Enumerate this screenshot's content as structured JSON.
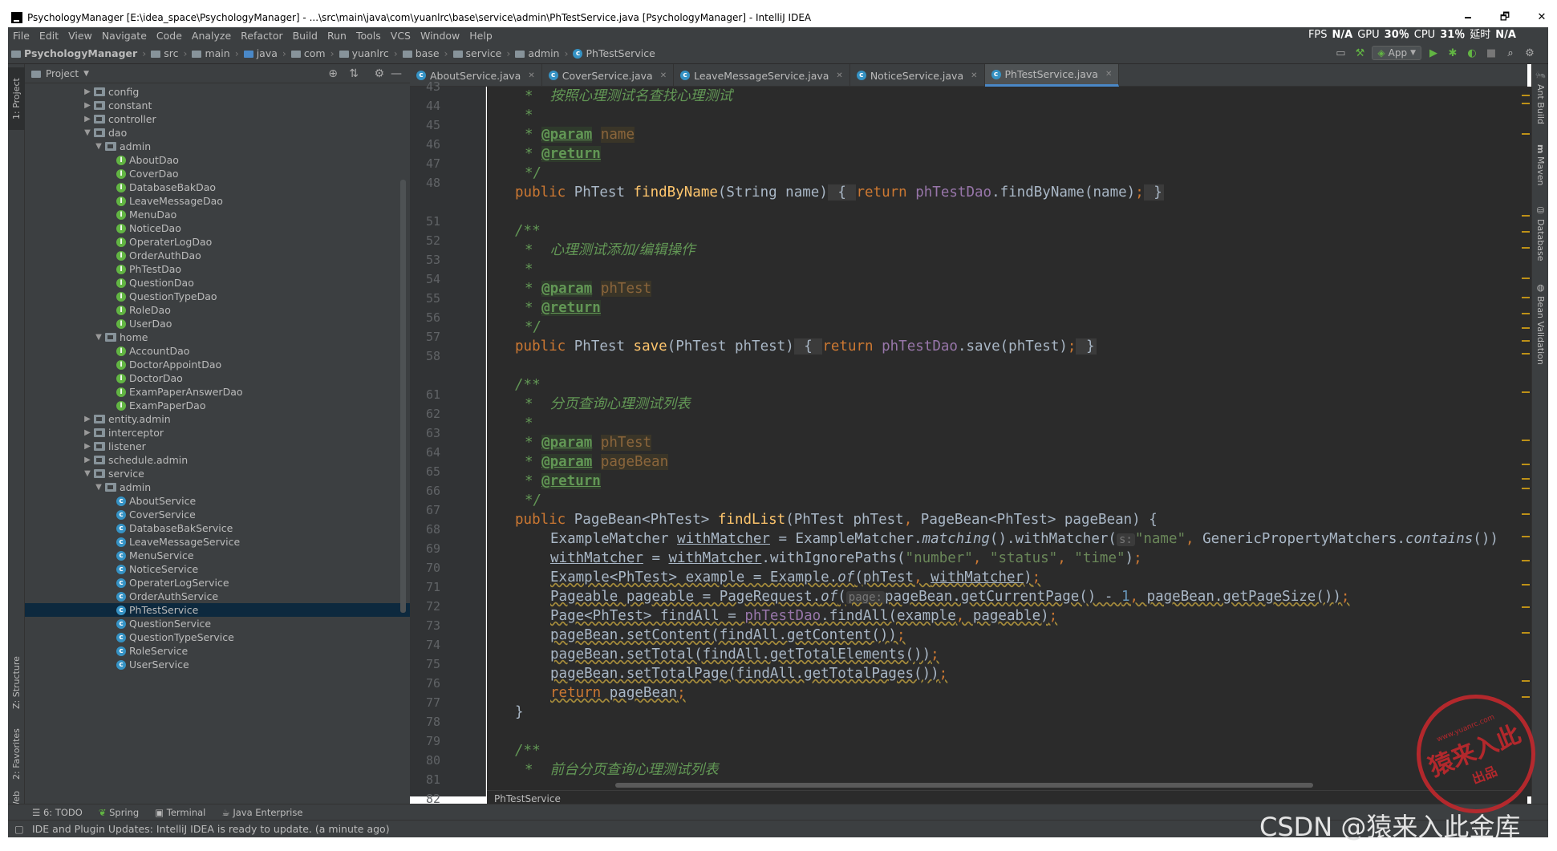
{
  "window": {
    "title": "PsychologyManager [E:\\idea_space\\PsychologyManager] - ...\\src\\main\\java\\com\\yuanlrc\\base\\service\\admin\\PhTestService.java [PsychologyManager] - IntelliJ IDEA",
    "minimize": "🗕",
    "maximize": "🗗",
    "close": "✕"
  },
  "menu": [
    "File",
    "Edit",
    "View",
    "Navigate",
    "Code",
    "Analyze",
    "Refactor",
    "Build",
    "Run",
    "Tools",
    "VCS",
    "Window",
    "Help"
  ],
  "perf": {
    "fps_label": "FPS",
    "fps": "N/A",
    "gpu_label": "GPU",
    "gpu": "30％",
    "cpu_label": "CPU",
    "cpu": "31％",
    "delay_label": "延时",
    "delay": "N/A"
  },
  "breadcrumb": [
    "PsychologyManager",
    "src",
    "main",
    "java",
    "com",
    "yuanlrc",
    "base",
    "service",
    "admin",
    "PhTestService"
  ],
  "run_config": "App",
  "left_tabs": [
    "1: Project",
    "Z: Structure",
    "2: Favorites",
    "Web"
  ],
  "right_tabs": [
    "Ant Build",
    "Maven",
    "Database",
    "Bean Validation"
  ],
  "project_panel": {
    "title": "Project"
  },
  "tree": [
    {
      "depth": 0,
      "type": "folder",
      "arrow": "▶",
      "label": "config"
    },
    {
      "depth": 0,
      "type": "folder",
      "arrow": "▶",
      "label": "constant"
    },
    {
      "depth": 0,
      "type": "folder",
      "arrow": "▶",
      "label": "controller"
    },
    {
      "depth": 0,
      "type": "folder",
      "arrow": "▼",
      "label": "dao"
    },
    {
      "depth": 1,
      "type": "folder",
      "arrow": "▼",
      "label": "admin"
    },
    {
      "depth": 2,
      "type": "iface",
      "label": "AboutDao"
    },
    {
      "depth": 2,
      "type": "iface",
      "label": "CoverDao"
    },
    {
      "depth": 2,
      "type": "iface",
      "label": "DatabaseBakDao"
    },
    {
      "depth": 2,
      "type": "iface",
      "label": "LeaveMessageDao"
    },
    {
      "depth": 2,
      "type": "iface",
      "label": "MenuDao"
    },
    {
      "depth": 2,
      "type": "iface",
      "label": "NoticeDao"
    },
    {
      "depth": 2,
      "type": "iface",
      "label": "OperaterLogDao"
    },
    {
      "depth": 2,
      "type": "iface",
      "label": "OrderAuthDao"
    },
    {
      "depth": 2,
      "type": "iface",
      "label": "PhTestDao"
    },
    {
      "depth": 2,
      "type": "iface",
      "label": "QuestionDao"
    },
    {
      "depth": 2,
      "type": "iface",
      "label": "QuestionTypeDao"
    },
    {
      "depth": 2,
      "type": "iface",
      "label": "RoleDao"
    },
    {
      "depth": 2,
      "type": "iface",
      "label": "UserDao"
    },
    {
      "depth": 1,
      "type": "folder",
      "arrow": "▼",
      "label": "home"
    },
    {
      "depth": 2,
      "type": "iface",
      "label": "AccountDao"
    },
    {
      "depth": 2,
      "type": "iface",
      "label": "DoctorAppointDao"
    },
    {
      "depth": 2,
      "type": "iface",
      "label": "DoctorDao"
    },
    {
      "depth": 2,
      "type": "iface",
      "label": "ExamPaperAnswerDao"
    },
    {
      "depth": 2,
      "type": "iface",
      "label": "ExamPaperDao"
    },
    {
      "depth": 0,
      "type": "folder",
      "arrow": "▶",
      "label": "entity.admin"
    },
    {
      "depth": 0,
      "type": "folder",
      "arrow": "▶",
      "label": "interceptor"
    },
    {
      "depth": 0,
      "type": "folder",
      "arrow": "▶",
      "label": "listener"
    },
    {
      "depth": 0,
      "type": "folder",
      "arrow": "▶",
      "label": "schedule.admin"
    },
    {
      "depth": 0,
      "type": "folder",
      "arrow": "▼",
      "label": "service"
    },
    {
      "depth": 1,
      "type": "folder",
      "arrow": "▼",
      "label": "admin"
    },
    {
      "depth": 2,
      "type": "class",
      "label": "AboutService"
    },
    {
      "depth": 2,
      "type": "class",
      "label": "CoverService"
    },
    {
      "depth": 2,
      "type": "class",
      "label": "DatabaseBakService"
    },
    {
      "depth": 2,
      "type": "class",
      "label": "LeaveMessageService"
    },
    {
      "depth": 2,
      "type": "class",
      "label": "MenuService"
    },
    {
      "depth": 2,
      "type": "class",
      "label": "NoticeService"
    },
    {
      "depth": 2,
      "type": "class",
      "label": "OperaterLogService"
    },
    {
      "depth": 2,
      "type": "class",
      "label": "OrderAuthService"
    },
    {
      "depth": 2,
      "type": "class",
      "label": "PhTestService",
      "selected": true
    },
    {
      "depth": 2,
      "type": "class",
      "label": "QuestionService"
    },
    {
      "depth": 2,
      "type": "class",
      "label": "QuestionTypeService"
    },
    {
      "depth": 2,
      "type": "class",
      "label": "RoleService"
    },
    {
      "depth": 2,
      "type": "class",
      "label": "UserService"
    }
  ],
  "editor_tabs": [
    {
      "label": "AboutService.java",
      "active": false
    },
    {
      "label": "CoverService.java",
      "active": false
    },
    {
      "label": "LeaveMessageService.java",
      "active": false
    },
    {
      "label": "NoticeService.java",
      "active": false
    },
    {
      "label": "PhTestService.java",
      "active": true
    }
  ],
  "line_numbers": [
    "43",
    "44",
    "45",
    "46",
    "47",
    "48",
    "51",
    "52",
    "53",
    "54",
    "55",
    "56",
    "57",
    "58",
    "61",
    "62",
    "63",
    "64",
    "65",
    "66",
    "67",
    "68",
    "69",
    "70",
    "71",
    "72",
    "73",
    "74",
    "75",
    "76",
    "77",
    "78",
    "79",
    "80",
    "81",
    "82"
  ],
  "code": {
    "c43": "按照心理测试名查找心理测试",
    "c45_tag": "@param",
    "c45_p": "name",
    "c46_tag": "@return",
    "c53": "心理测试添加/编辑操作",
    "c55_tag": "@param",
    "c55_p": "phTest",
    "c56_tag": "@return",
    "c63": "分页查询心理测试列表",
    "c65_tag": "@param",
    "c65_p": "phTest",
    "c66_tag": "@param",
    "c66_p": "pageBean",
    "c67_tag": "@return",
    "c82": "前台分页查询心理测试列表",
    "hint_s": "s:",
    "hint_page": "page:"
  },
  "editor_crumb": "PhTestService",
  "bottom_tabs": [
    "6: TODO",
    "Spring",
    "Terminal",
    "Java Enterprise"
  ],
  "status_message": "IDE and Plugin Updates: IntelliJ IDEA is ready to update. (a minute ago)",
  "watermark": "CSDN @猿来入此金库",
  "stamp": {
    "top": "www.yuanrc.com",
    "main": "猿来入此",
    "sub": "出品"
  }
}
